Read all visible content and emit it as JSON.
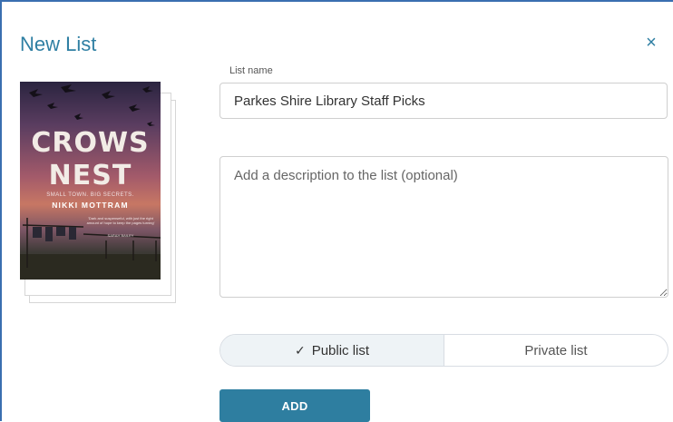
{
  "dialog": {
    "title": "New List",
    "close_icon": "×"
  },
  "book": {
    "title_line1": "CROWS",
    "title_line2": "NEST",
    "tagline": "SMALL TOWN. BIG SECRETS.",
    "author": "NIKKI MOTTRAM",
    "blurb": "'Dark and suspenseful, with just the right amount of hope to keep the pages turning'",
    "blurb_source": "SARAH BAILEY"
  },
  "form": {
    "name_label": "List name",
    "name_value": "Parkes Shire Library Staff Picks",
    "description_placeholder": "Add a description to the list (optional)",
    "visibility": {
      "public_label": "Public list",
      "private_label": "Private list",
      "selected": "public",
      "check_icon": "✓"
    },
    "add_label": "ADD"
  },
  "colors": {
    "accent": "#2f7fa3",
    "button": "#2e7ea0",
    "border": "#3a6fb0"
  }
}
